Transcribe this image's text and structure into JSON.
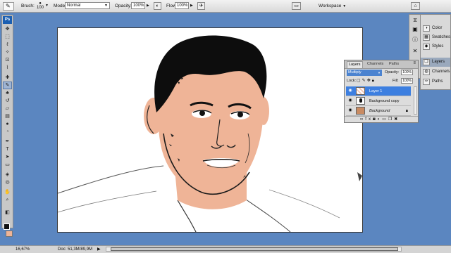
{
  "options_bar": {
    "brush_label": "Brush:",
    "brush_size": "100",
    "mode_label": "Mode:",
    "mode_value": "Normal",
    "opacity_label": "Opacity:",
    "opacity_value": "100%",
    "flow_label": "Flow:",
    "flow_value": "100%",
    "workspace_label": "Workspace"
  },
  "toolbox": {
    "logo": "Ps",
    "tools": [
      "move-tool",
      "marquee-tool",
      "lasso-tool",
      "quick-selection-tool",
      "crop-tool",
      "eyedropper-tool",
      "healing-brush-tool",
      "brush-tool",
      "clone-stamp-tool",
      "history-brush-tool",
      "eraser-tool",
      "gradient-tool",
      "blur-tool",
      "dodge-tool",
      "pen-tool",
      "type-tool",
      "path-selection-tool",
      "shape-tool",
      "hand-tool",
      "zoom-tool"
    ],
    "active_tool": "brush-tool",
    "foreground_color": "#111111",
    "background_color": "#efb497"
  },
  "panels_collapsed": [
    {
      "label": "Color",
      "icon": "color-icon"
    },
    {
      "label": "Swatches",
      "icon": "swatches-icon"
    },
    {
      "label": "Styles",
      "icon": "styles-icon"
    },
    {
      "label": "Layers",
      "icon": "layers-icon",
      "selected": true
    },
    {
      "label": "Channels",
      "icon": "channels-icon"
    },
    {
      "label": "Paths",
      "icon": "paths-icon"
    }
  ],
  "layers_panel": {
    "tabs": [
      "Layers",
      "Channels",
      "Paths"
    ],
    "active_tab": "Layers",
    "blend_mode": "Multiply",
    "opacity_label": "Opacity:",
    "opacity_value": "100%",
    "lock_label": "Lock:",
    "fill_label": "Fill:",
    "fill_value": "100%",
    "layers": [
      {
        "name": "Layer 1",
        "selected": true,
        "visible": true,
        "locked": false,
        "italic": false
      },
      {
        "name": "Background copy",
        "selected": false,
        "visible": true,
        "locked": false,
        "italic": false
      },
      {
        "name": "Background",
        "selected": false,
        "visible": true,
        "locked": true,
        "italic": true
      }
    ]
  },
  "status_bar": {
    "zoom": "16,67%",
    "doc_size": "Doc: 51,3M/89,9M"
  },
  "colors": {
    "workspace_bg": "#5b86c0",
    "skin": "#efb497",
    "selection_blue": "#3d7fe0"
  }
}
